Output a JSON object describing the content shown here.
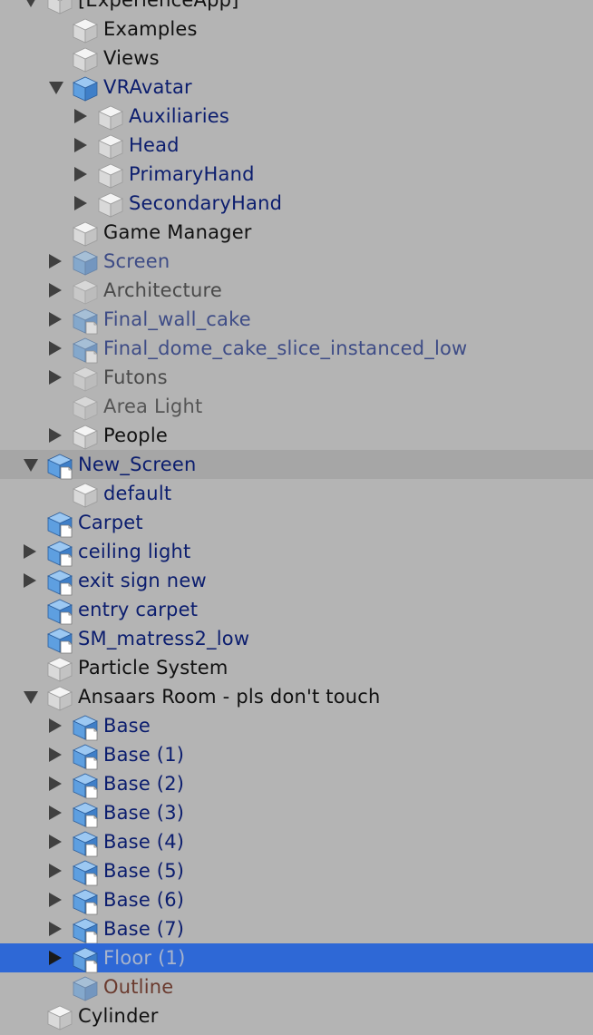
{
  "hierarchy": {
    "rows": [
      {
        "label": "[ExperienceApp]",
        "depth": 1,
        "arrow": "expanded",
        "icon": "cube-grey-icon",
        "color": "black"
      },
      {
        "label": "Examples",
        "depth": 2,
        "arrow": "none",
        "icon": "cube-grey-icon",
        "color": "black"
      },
      {
        "label": "Views",
        "depth": 2,
        "arrow": "none",
        "icon": "cube-grey-icon",
        "color": "black"
      },
      {
        "label": "VRAvatar",
        "depth": 2,
        "arrow": "expanded",
        "icon": "cube-blue-icon",
        "color": "navy"
      },
      {
        "label": "Auxiliaries",
        "depth": 3,
        "arrow": "collapsed",
        "icon": "cube-grey-icon",
        "color": "navy"
      },
      {
        "label": "Head",
        "depth": 3,
        "arrow": "collapsed",
        "icon": "cube-grey-icon",
        "color": "navy"
      },
      {
        "label": "PrimaryHand",
        "depth": 3,
        "arrow": "collapsed",
        "icon": "cube-grey-icon",
        "color": "navy"
      },
      {
        "label": "SecondaryHand",
        "depth": 3,
        "arrow": "collapsed",
        "icon": "cube-grey-icon",
        "color": "navy"
      },
      {
        "label": "Game Manager",
        "depth": 2,
        "arrow": "none",
        "icon": "cube-grey-icon",
        "color": "black"
      },
      {
        "label": "Screen",
        "depth": 2,
        "arrow": "collapsed",
        "icon": "cube-blue-icon",
        "color": "slate",
        "faded": true
      },
      {
        "label": "Architecture",
        "depth": 2,
        "arrow": "collapsed",
        "icon": "cube-grey-icon",
        "color": "grey",
        "faded": true
      },
      {
        "label": "Final_wall_cake",
        "depth": 2,
        "arrow": "collapsed",
        "icon": "cube-prefab-model-icon",
        "color": "slate",
        "faded": true
      },
      {
        "label": "Final_dome_cake_slice_instanced_low",
        "depth": 2,
        "arrow": "collapsed",
        "icon": "cube-prefab-model-icon",
        "color": "slate",
        "faded": true
      },
      {
        "label": "Futons",
        "depth": 2,
        "arrow": "collapsed",
        "icon": "cube-grey-icon",
        "color": "grey",
        "faded": true
      },
      {
        "label": "Area Light",
        "depth": 2,
        "arrow": "none",
        "icon": "cube-grey-icon",
        "color": "dim",
        "faded": true
      },
      {
        "label": "People",
        "depth": 2,
        "arrow": "collapsed",
        "icon": "cube-grey-icon",
        "color": "black"
      },
      {
        "label": "New_Screen",
        "depth": 1,
        "arrow": "expanded",
        "icon": "cube-prefab-model-icon",
        "color": "navy",
        "state": "hover"
      },
      {
        "label": "default",
        "depth": 2,
        "arrow": "none",
        "icon": "cube-grey-icon",
        "color": "navy"
      },
      {
        "label": "Carpet",
        "depth": 1,
        "arrow": "none",
        "icon": "cube-prefab-model-icon",
        "color": "navy"
      },
      {
        "label": "ceiling light",
        "depth": 1,
        "arrow": "collapsed",
        "icon": "cube-prefab-model-icon",
        "color": "navy"
      },
      {
        "label": "exit sign new",
        "depth": 1,
        "arrow": "collapsed",
        "icon": "cube-prefab-model-icon",
        "color": "navy"
      },
      {
        "label": "entry carpet",
        "depth": 1,
        "arrow": "none",
        "icon": "cube-prefab-model-icon",
        "color": "navy"
      },
      {
        "label": "SM_matress2_low",
        "depth": 1,
        "arrow": "none",
        "icon": "cube-prefab-model-icon",
        "color": "navy"
      },
      {
        "label": "Particle System",
        "depth": 1,
        "arrow": "none",
        "icon": "cube-grey-icon",
        "color": "black"
      },
      {
        "label": "Ansaars Room - pls don't touch",
        "depth": 1,
        "arrow": "expanded",
        "icon": "cube-grey-icon",
        "color": "black"
      },
      {
        "label": "Base",
        "depth": 2,
        "arrow": "collapsed",
        "icon": "cube-prefab-model-icon",
        "color": "navy"
      },
      {
        "label": "Base (1)",
        "depth": 2,
        "arrow": "collapsed",
        "icon": "cube-prefab-model-icon",
        "color": "navy"
      },
      {
        "label": "Base (2)",
        "depth": 2,
        "arrow": "collapsed",
        "icon": "cube-prefab-model-icon",
        "color": "navy"
      },
      {
        "label": "Base (3)",
        "depth": 2,
        "arrow": "collapsed",
        "icon": "cube-prefab-model-icon",
        "color": "navy"
      },
      {
        "label": "Base (4)",
        "depth": 2,
        "arrow": "collapsed",
        "icon": "cube-prefab-model-icon",
        "color": "navy"
      },
      {
        "label": "Base (5)",
        "depth": 2,
        "arrow": "collapsed",
        "icon": "cube-prefab-model-icon",
        "color": "navy"
      },
      {
        "label": "Base (6)",
        "depth": 2,
        "arrow": "collapsed",
        "icon": "cube-prefab-model-icon",
        "color": "navy"
      },
      {
        "label": "Base (7)",
        "depth": 2,
        "arrow": "collapsed",
        "icon": "cube-prefab-model-icon",
        "color": "navy"
      },
      {
        "label": "Floor (1)",
        "depth": 2,
        "arrow": "collapsed",
        "icon": "cube-prefab-model-icon",
        "color": "sel",
        "state": "selected"
      },
      {
        "label": "Outline",
        "depth": 2,
        "arrow": "none",
        "icon": "cube-blue-icon",
        "color": "brown",
        "faded": true
      },
      {
        "label": "Cylinder",
        "depth": 1,
        "arrow": "none",
        "icon": "cube-grey-icon",
        "color": "black"
      }
    ]
  },
  "colors": {
    "background": "#b4b4b4",
    "hover_row": "#a6a6a6",
    "selected_row": "#2e68d6",
    "navy_text": "#0b1d6e"
  }
}
